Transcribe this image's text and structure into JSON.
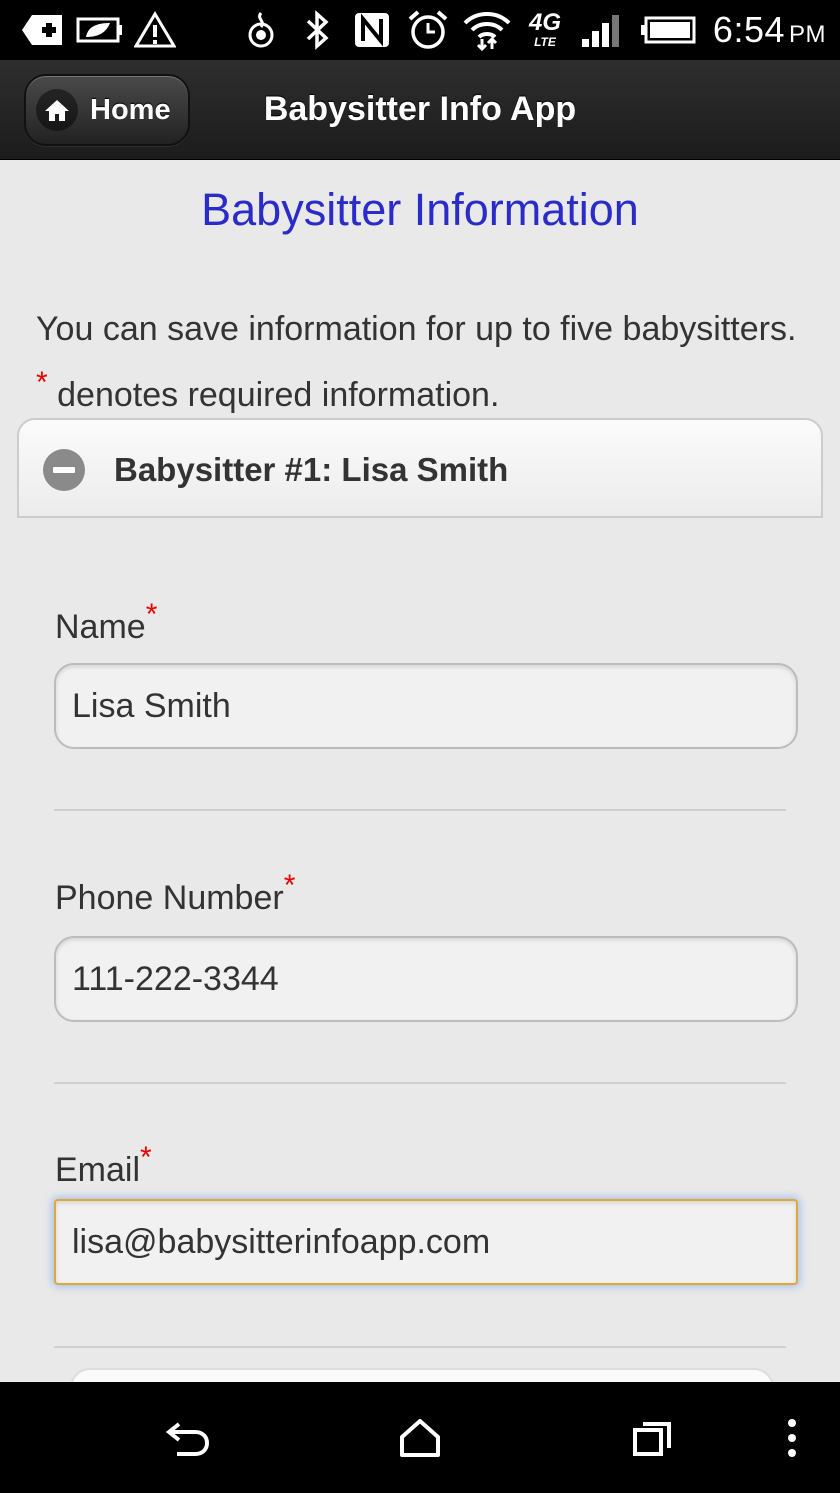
{
  "status_bar": {
    "time": "6:54",
    "ampm": "PM",
    "icons": [
      "medical-plus-icon",
      "clear-notifications-icon",
      "leaf-battery-icon",
      "warning-icon",
      "sense-icon",
      "bluetooth-icon",
      "nfc-icon",
      "alarm-icon",
      "wifi-icon",
      "4g-lte-icon",
      "signal-icon",
      "battery-icon"
    ],
    "network_label": "4G",
    "network_sub": "LTE"
  },
  "header": {
    "home_label": "Home",
    "title": "Babysitter Info App"
  },
  "page": {
    "title": "Babysitter Information",
    "intro_before": "You can save information for up to five babysitters. ",
    "required_marker": "*",
    "intro_after": " denotes required information."
  },
  "babysitter": {
    "section_label": "Babysitter #1: Lisa Smith",
    "fields": {
      "name": {
        "label": "Name",
        "value": "Lisa Smith"
      },
      "phone": {
        "label": "Phone Number",
        "value": "111-222-3344"
      },
      "email": {
        "label": "Email",
        "value": "lisa@babysitterinfoapp.com"
      }
    }
  },
  "colors": {
    "title_blue": "#2b2bc8",
    "required_red": "#e00000",
    "focus_border": "#e0a83a"
  }
}
